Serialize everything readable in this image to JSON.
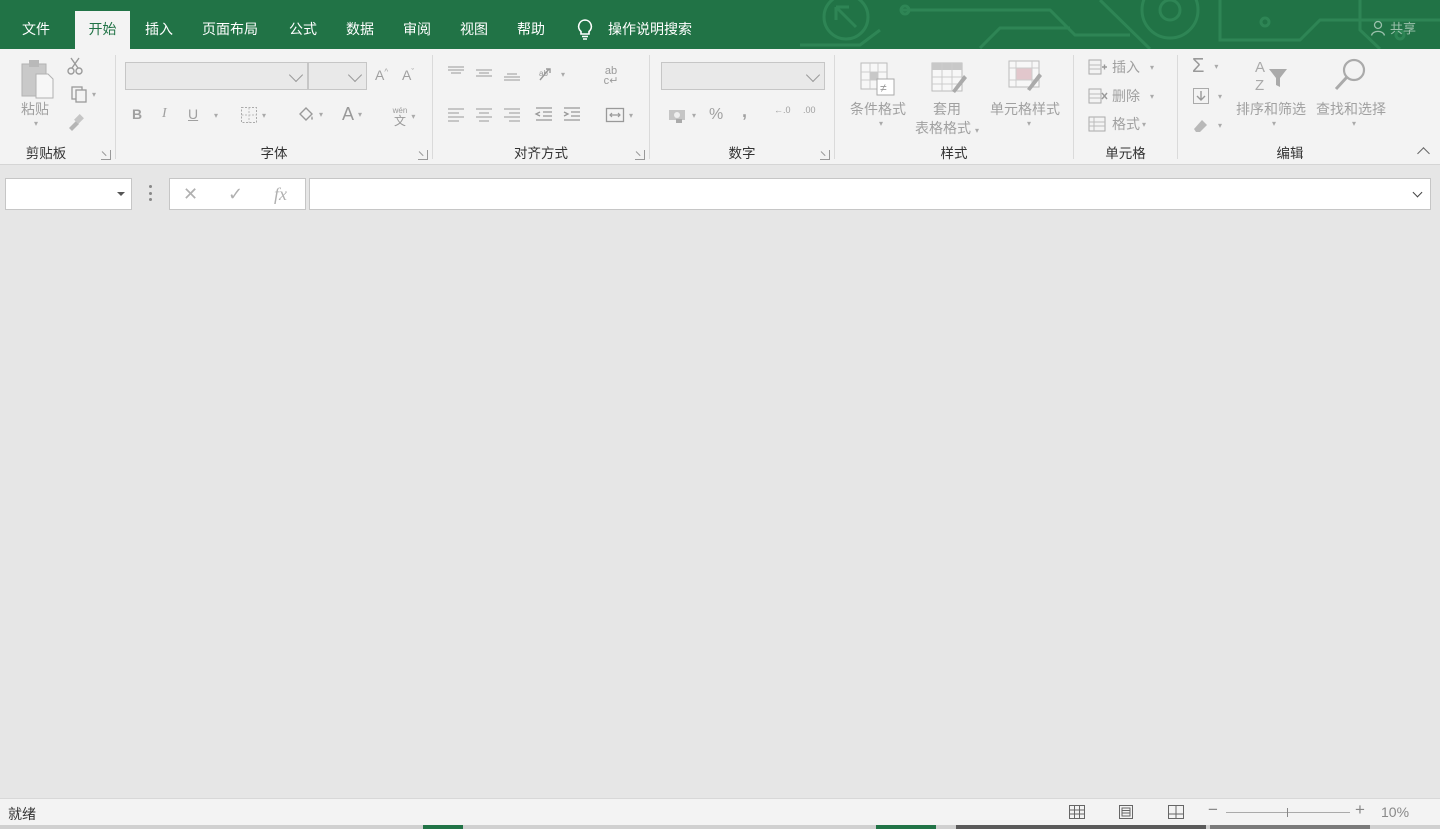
{
  "tabs": {
    "file": "文件",
    "home": "开始",
    "insert": "插入",
    "page_layout": "页面布局",
    "formulas": "公式",
    "data": "数据",
    "review": "审阅",
    "view": "视图",
    "help": "帮助"
  },
  "tell_me": "操作说明搜索",
  "share": "共享",
  "ribbon": {
    "clipboard": {
      "label": "剪贴板",
      "paste": "粘贴"
    },
    "font": {
      "label": "字体",
      "font_name": "",
      "font_size": "",
      "bold": "B",
      "italic": "I",
      "underline": "U",
      "grow": "A",
      "shrink": "A",
      "font_color": "A",
      "phonetic_top": "wén",
      "phonetic_bottom": "文"
    },
    "alignment": {
      "label": "对齐方式"
    },
    "number": {
      "label": "数字",
      "format": "",
      "percent": "%",
      "comma": ",",
      "inc_decimal": "←.0",
      "dec_decimal": ".00"
    },
    "styles": {
      "label": "样式",
      "conditional": "条件格式",
      "table_line1": "套用",
      "table_line2": "表格格式",
      "cell_styles": "单元格样式"
    },
    "cells": {
      "label": "单元格",
      "insert": "插入",
      "delete": "删除",
      "format": "格式"
    },
    "editing": {
      "label": "编辑",
      "sort_filter": "排序和筛选",
      "find_select": "查找和选择"
    }
  },
  "formula_bar": {
    "name_box": "",
    "cancel": "✕",
    "enter": "✓",
    "fx": "fx",
    "content": ""
  },
  "status_bar": {
    "ready": "就绪",
    "zoom_minus": "−",
    "zoom_plus": "+",
    "zoom": "10%"
  },
  "colors": {
    "accent": "#217346",
    "workspace": "#e6e6e6",
    "ribbon_bg": "#f3f3f3"
  }
}
